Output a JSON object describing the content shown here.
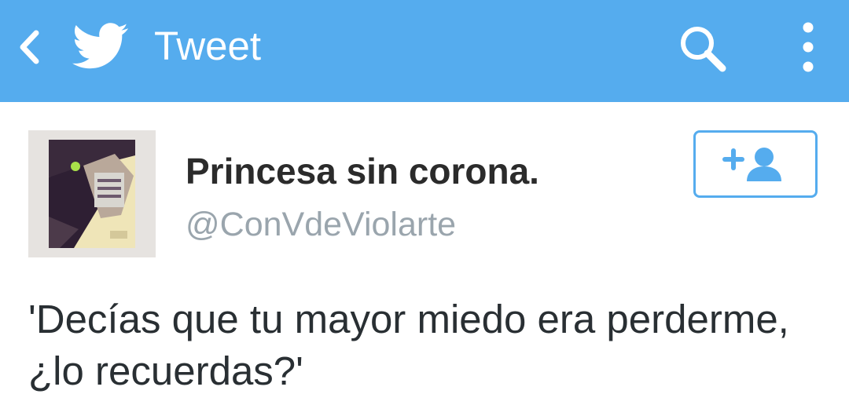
{
  "action_bar": {
    "title": "Tweet",
    "background_color": "#55acee",
    "icons": {
      "back": "chevron-left-icon",
      "logo": "twitter-bird-icon",
      "search": "search-icon",
      "overflow": "more-vertical-icon"
    }
  },
  "tweet": {
    "author": {
      "display_name": "Princesa sin corona.",
      "screen_name": "@ConVdeViolarte",
      "avatar": "profile-photo"
    },
    "follow_button": {
      "icon": "add-user-icon",
      "accent_color": "#55acee"
    },
    "text": "'Decías que tu mayor miedo era perderme, ¿lo recuerdas?'"
  }
}
